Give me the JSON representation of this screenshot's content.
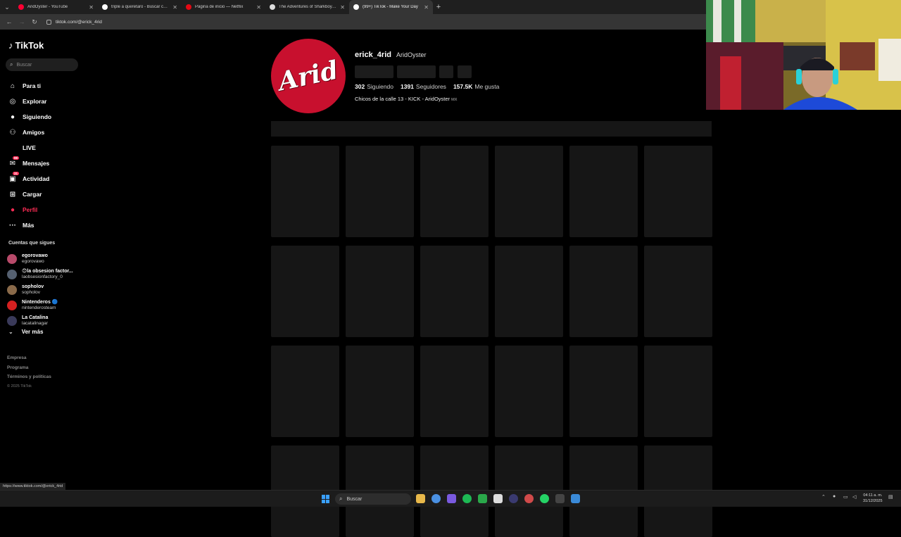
{
  "browser": {
    "tabs": [
      {
        "title": "AridOyster - YouTube",
        "favicon_color": "#ff0033",
        "active": false
      },
      {
        "title": "triple a queretaro - Buscar con Google",
        "favicon_color": "#ffffff",
        "active": false
      },
      {
        "title": "Página de inicio — Netflix",
        "favicon_color": "#e50914",
        "active": false
      },
      {
        "title": "The Adventures of Sharkboy and Lavagirl",
        "favicon_color": "#dddddd",
        "active": false
      },
      {
        "title": "(99+) TikTok - Make Your Day",
        "favicon_color": "#ffffff",
        "active": true
      }
    ],
    "new_tab": "+",
    "url": "tiktok.com/@erick_4rid",
    "status_url": "https://www.tiktok.com/@erick_4rid"
  },
  "sidebar": {
    "logo": "TikTok",
    "search_placeholder": "Buscar",
    "nav": [
      {
        "label": "Para ti",
        "icon": "home-icon",
        "glyph": "⌂"
      },
      {
        "label": "Explorar",
        "icon": "compass-icon",
        "glyph": "◎"
      },
      {
        "label": "Siguiendo",
        "icon": "following-avatar-icon",
        "glyph": "●"
      },
      {
        "label": "Amigos",
        "icon": "friends-icon",
        "glyph": "⚇"
      },
      {
        "label": "LIVE",
        "icon": "live-icon",
        "glyph": ""
      },
      {
        "label": "Mensajes",
        "icon": "message-icon",
        "glyph": "✉",
        "badge": "99"
      },
      {
        "label": "Actividad",
        "icon": "inbox-icon",
        "glyph": "▣",
        "badge": "31"
      },
      {
        "label": "Cargar",
        "icon": "upload-icon",
        "glyph": "⊞"
      },
      {
        "label": "Perfil",
        "icon": "profile-icon",
        "glyph": "●",
        "highlight": true
      },
      {
        "label": "Más",
        "icon": "more-icon",
        "glyph": "···"
      }
    ],
    "following_title": "Cuentas que sigues",
    "following": [
      {
        "name": "egorovawo",
        "handle": "egorovawo",
        "color": "#b84a6a"
      },
      {
        "name": "😊la obsesion factor...",
        "handle": "laobsesionfactory_0",
        "color": "#556070"
      },
      {
        "name": "sopholov",
        "handle": "sopholov",
        "color": "#8a6a4a"
      },
      {
        "name": "Nintenderos 🔵",
        "handle": "nintenderosteam",
        "color": "#d42020"
      },
      {
        "name": "La Catalina",
        "handle": "lacatalinagar",
        "color": "#3a3a5a"
      }
    ],
    "see_more": "Ver más",
    "footer": [
      "Empresa",
      "Programa",
      "Términos y políticas"
    ],
    "copyright": "© 2025 TikTok"
  },
  "profile": {
    "avatar_text": "Arid",
    "username": "erick_4rid",
    "nickname": "AridOyster",
    "following_count": "302",
    "following_label": "Siguiendo",
    "followers_count": "1391",
    "followers_label": "Seguidores",
    "likes_count": "157.5K",
    "likes_label": "Me gusta",
    "bio": "Chicos de la calle 13 - KICK - AridOyster",
    "bio_suffix": "MX"
  },
  "taskbar": {
    "search_placeholder": "Buscar",
    "time": "04:11 a. m.",
    "date": "31/12/2025"
  },
  "colors": {
    "accent": "#fe2c55",
    "background": "#000000",
    "skeleton": "#161616"
  }
}
